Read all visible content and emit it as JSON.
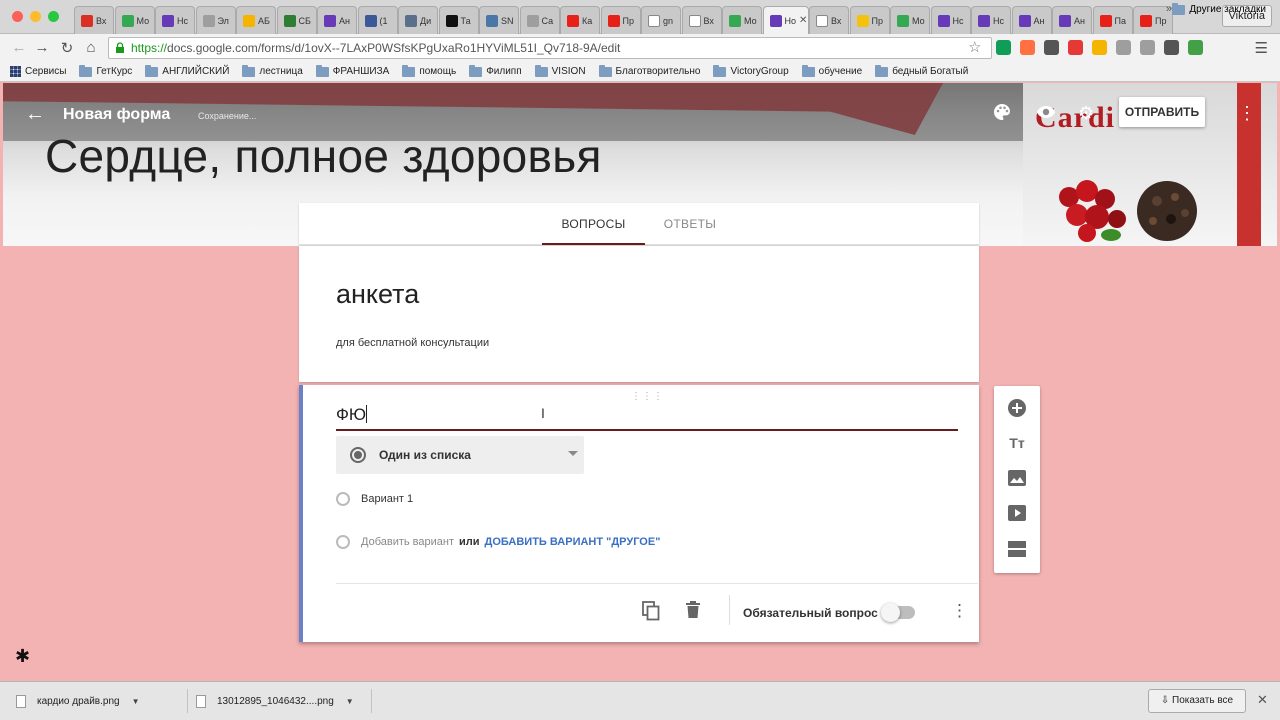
{
  "browser": {
    "tabs": [
      {
        "label": "Вх",
        "color": "#d93025"
      },
      {
        "label": "Мо",
        "color": "#34a853"
      },
      {
        "label": "Нс",
        "color": "#673ab7"
      },
      {
        "label": "Эл",
        "color": "#9e9e9e"
      },
      {
        "label": "АБ",
        "color": "#f4b400"
      },
      {
        "label": "СБ",
        "color": "#2e7d32"
      },
      {
        "label": "Ан",
        "color": "#673ab7"
      },
      {
        "label": "(1",
        "color": "#3b5998"
      },
      {
        "label": "Ди",
        "color": "#5a6f8c"
      },
      {
        "label": "Та",
        "color": "#111111"
      },
      {
        "label": "SN",
        "color": "#4a76a8"
      },
      {
        "label": "Са",
        "color": "#9e9e9e"
      },
      {
        "label": "Ка",
        "color": "#e62117"
      },
      {
        "label": "Пр",
        "color": "#e62117"
      },
      {
        "label": "gn",
        "color": "#ffffff"
      },
      {
        "label": "Вх",
        "color": "#ffffff"
      },
      {
        "label": "Мо",
        "color": "#34a853"
      },
      {
        "label": "Но",
        "color": "#673ab7",
        "active": true
      },
      {
        "label": "Вх",
        "color": "#ffffff"
      },
      {
        "label": "Пр",
        "color": "#f4c20d"
      },
      {
        "label": "Мо",
        "color": "#34a853"
      },
      {
        "label": "Нс",
        "color": "#673ab7"
      },
      {
        "label": "Нс",
        "color": "#673ab7"
      },
      {
        "label": "Ан",
        "color": "#673ab7"
      },
      {
        "label": "Ан",
        "color": "#673ab7"
      },
      {
        "label": "Па",
        "color": "#e62117"
      },
      {
        "label": "Пр",
        "color": "#e62117"
      }
    ],
    "tab_close": "✕",
    "profile_name": "Viktoria",
    "url_scheme": "https://",
    "url_rest": "docs.google.com/forms/d/1ovX--7LAxP0WSfsKPgUxaRo1HYViML51I_Qv718-9A/edit",
    "extension_colors": [
      "#0f9d58",
      "#ff7043",
      "#555555",
      "#e53935",
      "#f4b400",
      "#9e9e9e",
      "#9e9e9e",
      "#555555",
      "#43a047"
    ],
    "bookmarks": [
      {
        "label": "Сервисы",
        "icon": "apps-grid-icon"
      },
      {
        "label": "ГетКурс",
        "icon": "folder-icon"
      },
      {
        "label": "АНГЛИЙСКИЙ",
        "icon": "folder-icon"
      },
      {
        "label": "лестница",
        "icon": "folder-icon"
      },
      {
        "label": "ФРАНШИЗА",
        "icon": "folder-icon"
      },
      {
        "label": "помощь",
        "icon": "folder-icon"
      },
      {
        "label": "Филипп",
        "icon": "folder-icon"
      },
      {
        "label": "VISION",
        "icon": "folder-icon"
      },
      {
        "label": "Благотворительно",
        "icon": "folder-icon"
      },
      {
        "label": "VictoryGroup",
        "icon": "folder-icon"
      },
      {
        "label": "обучение",
        "icon": "folder-icon"
      },
      {
        "label": "бедный Богатый",
        "icon": "folder-icon"
      }
    ],
    "bookmarks_more": "»",
    "other_bookmarks": "Другие закладки"
  },
  "header": {
    "form_name": "Новая форма",
    "saving_status": "Сохранение...",
    "send_label": "ОТПРАВИТЬ",
    "heading": "Сердце, полное здоровья",
    "product_brand": "Cardi"
  },
  "form_tabs": {
    "questions": "ВОПРОСЫ",
    "answers": "ОТВЕТЫ"
  },
  "form": {
    "title": "анкета",
    "description": "для бесплатной консультации"
  },
  "question": {
    "title": "ФЮ",
    "type_label": "Один из списка",
    "options": [
      "Вариант 1"
    ],
    "add_option": "Добавить вариант",
    "or_label": "или",
    "add_other": "ДОБАВИТЬ ВАРИАНТ \"ДРУГОЕ\"",
    "required_label": "Обязательный вопрос",
    "required": false
  },
  "downloads": {
    "items": [
      "кардио драйв.png",
      "13012895_1046432....png"
    ],
    "show_all": "Показать все"
  },
  "colors": {
    "page_background": "#f4b3b3",
    "accent": "#6a1b1b",
    "card_focus_border": "#6a80c8",
    "link": "#3a6fc4"
  }
}
